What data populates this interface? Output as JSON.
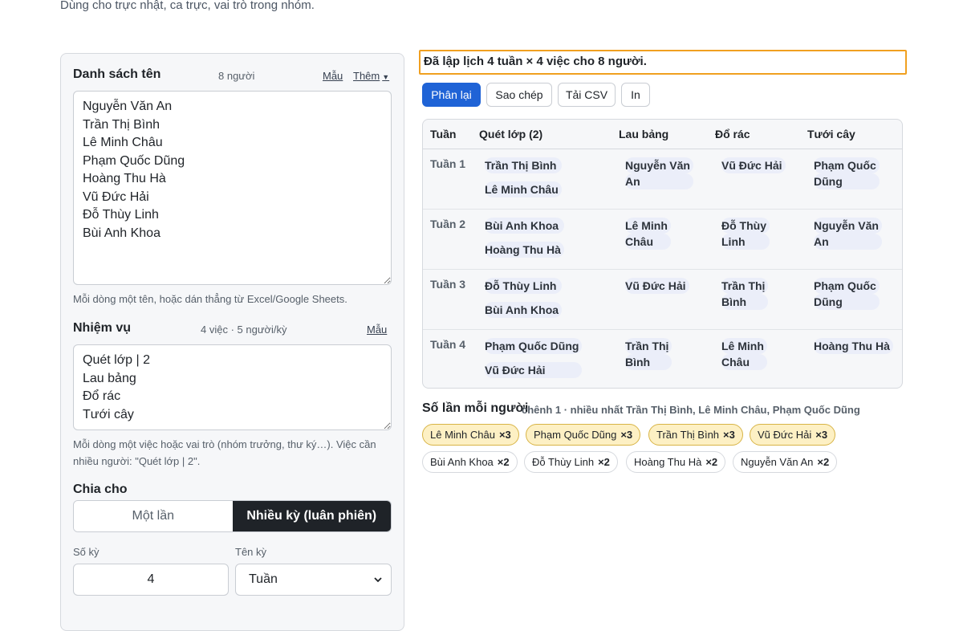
{
  "subtitle": "Dùng cho trực nhật, ca trực, vai trò trong nhóm.",
  "names": {
    "title": "Danh sách tên",
    "count": "8 người",
    "sample_label": "Mẫu",
    "more_label": "Thêm",
    "value": "Nguyễn Văn An\nTrần Thị Bình\nLê Minh Châu\nPhạm Quốc Dũng\nHoàng Thu Hà\nVũ Đức Hải\nĐỗ Thùy Linh\nBùi Anh Khoa",
    "hint": "Mỗi dòng một tên, hoặc dán thẳng từ Excel/Google Sheets."
  },
  "tasks": {
    "title": "Nhiệm vụ",
    "count": "4 việc · 5 người/kỳ",
    "sample_label": "Mẫu",
    "value": "Quét lớp | 2\nLau bảng\nĐổ rác\nTưới cây",
    "hint": "Mỗi dòng một việc hoặc vai trò (nhóm trưởng, thư ký…). Việc cần nhiều người: \"Quét lớp | 2\"."
  },
  "split": {
    "title": "Chia cho",
    "option_once": "Một lần",
    "option_multi": "Nhiều kỳ (luân phiên)",
    "selected": "Nhiều kỳ (luân phiên)"
  },
  "periods": {
    "count_label": "Số kỳ",
    "count_value": "4",
    "name_label": "Tên kỳ",
    "name_value": "Tuần"
  },
  "status": "Đã lập lịch 4 tuần × 4 việc cho 8 người.",
  "buttons": {
    "reassign": "Phân lại",
    "copy": "Sao chép",
    "csv": "Tải CSV",
    "print": "In"
  },
  "table": {
    "headers": [
      "Tuần",
      "Quét lớp (2)",
      "Lau bảng",
      "Đổ rác",
      "Tưới cây"
    ],
    "rows": [
      {
        "label": "Tuần 1",
        "sweep": [
          "Trần Thị Bình",
          "Lê Minh Châu"
        ],
        "board": [
          "Nguyễn Văn",
          "An"
        ],
        "trash": [
          "Vũ Đức Hải"
        ],
        "water": [
          "Phạm Quốc",
          "Dũng"
        ]
      },
      {
        "label": "Tuần 2",
        "sweep": [
          "Bùi Anh Khoa",
          "Hoàng Thu Hà"
        ],
        "board": [
          "Lê Minh",
          "Châu"
        ],
        "trash": [
          "Đỗ Thùy",
          "Linh"
        ],
        "water": [
          "Nguyễn Văn",
          "An"
        ]
      },
      {
        "label": "Tuần 3",
        "sweep": [
          "Đỗ Thùy Linh",
          "Bùi Anh Khoa"
        ],
        "board": [
          "Vũ Đức Hải"
        ],
        "trash": [
          "Trần Thị",
          "Bình"
        ],
        "water": [
          "Phạm Quốc",
          "Dũng"
        ]
      },
      {
        "label": "Tuần 4",
        "sweep": [
          "Phạm Quốc Dũng",
          "Vũ Đức Hải"
        ],
        "board": [
          "Trần Thị",
          "Bình"
        ],
        "trash": [
          "Lê Minh",
          "Châu"
        ],
        "water": [
          "Hoàng Thu Hà"
        ]
      }
    ]
  },
  "counts": {
    "title": "Số lần mỗi người",
    "summary": "chênh 1 · nhiều nhất Trần Thị Bình, Lê Minh Châu, Phạm Quốc Dũng",
    "chips": [
      {
        "name": "Lê Minh Châu",
        "count": "×3"
      },
      {
        "name": "Phạm Quốc Dũng",
        "count": "×3"
      },
      {
        "name": "Trần Thị Bình",
        "count": "×3"
      },
      {
        "name": "Vũ Đức Hải",
        "count": "×3"
      },
      {
        "name": "Bùi Anh Khoa",
        "count": "×2"
      },
      {
        "name": "Đỗ Thùy Linh",
        "count": "×2"
      },
      {
        "name": "Hoàng Thu Hà",
        "count": "×2"
      },
      {
        "name": "Nguyễn Văn An",
        "count": "×2"
      }
    ]
  },
  "colors": {
    "primary": "#1f63d6",
    "highlight_border": "#f0a020",
    "chip_high_bg": "#fdf0c4",
    "segment_active_bg": "#1f2328"
  }
}
